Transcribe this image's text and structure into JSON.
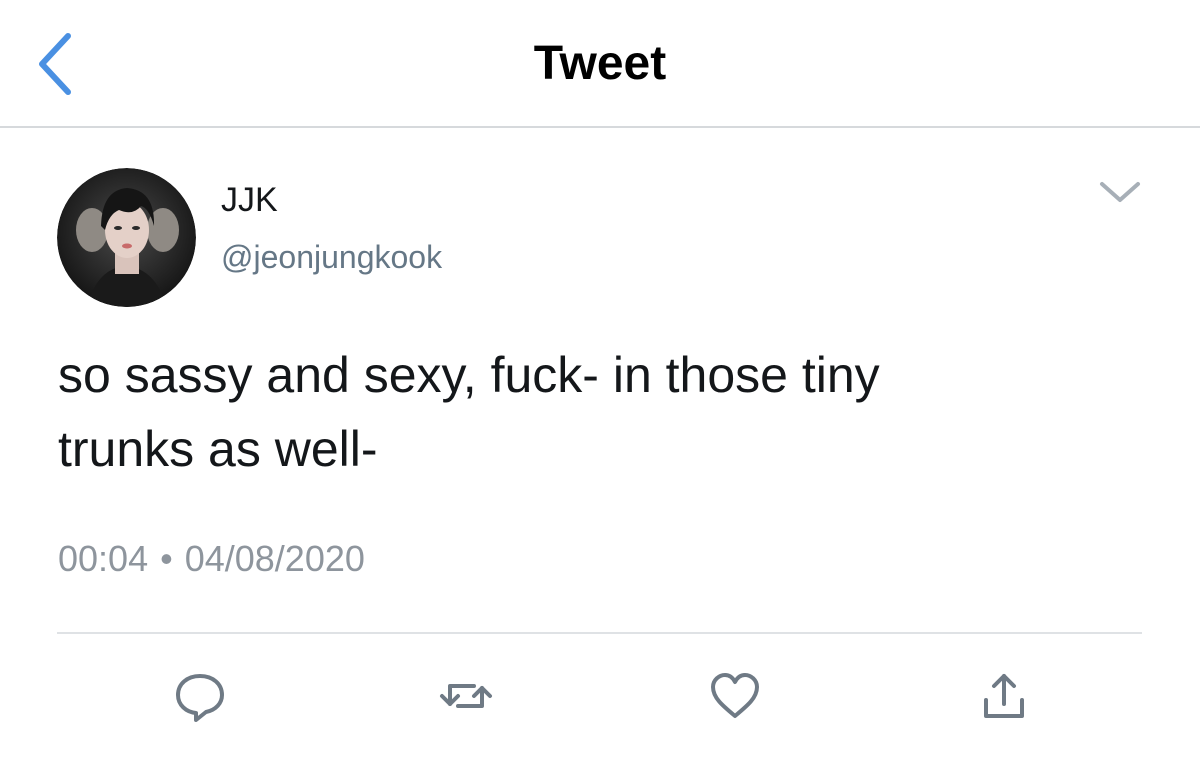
{
  "header": {
    "title": "Tweet",
    "back_icon": "chevron-left-icon",
    "accent_color": "#4a90e2"
  },
  "tweet": {
    "author": {
      "display_name": "JJK",
      "handle": "@jeonjungkook",
      "avatar_icon": "avatar-photo"
    },
    "text_lines": [
      "so sassy and sexy, fuck- in those tiny",
      "trunks as well-"
    ],
    "time": "00:04",
    "separator": "•",
    "date": "04/08/2020",
    "menu_icon": "chevron-down-icon"
  },
  "actions": [
    {
      "name": "reply",
      "icon": "reply-icon"
    },
    {
      "name": "retweet",
      "icon": "retweet-icon"
    },
    {
      "name": "like",
      "icon": "heart-icon"
    },
    {
      "name": "share",
      "icon": "share-icon"
    }
  ],
  "colors": {
    "text": "#14171a",
    "secondary_text": "#657786",
    "icon_gray": "#6f7a85",
    "divider": "#dfe2e5"
  }
}
